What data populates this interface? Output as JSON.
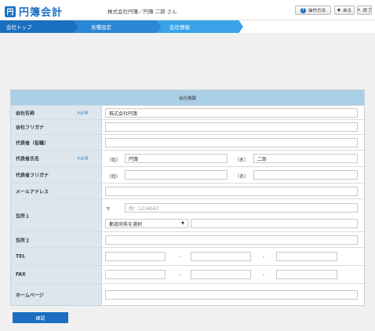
{
  "header": {
    "logo_icon": "円",
    "app_name": "円簿会計",
    "company_user": "株式会社円簿／円簿 二郎 さん",
    "help_label": "操作方法",
    "back_label": "戻る",
    "exit_label": "終了",
    "help_icon": "?",
    "back_icon": "◆",
    "exit_icon": "×"
  },
  "breadcrumb": [
    "会社トップ",
    "各種設定",
    "会社情報"
  ],
  "form": {
    "title": "会社情報",
    "required_mark": "※必須",
    "labels": {
      "company_name": "会社名称",
      "company_kana": "会社フリガナ",
      "representative_title": "代表者（役職）",
      "representative_name": "代表者氏名",
      "representative_kana": "代表者フリガナ",
      "email": "メールアドレス",
      "address1": "住所１",
      "address2": "住所２",
      "tel": "TEL",
      "fax": "FAX",
      "homepage": "ホームページ"
    },
    "values": {
      "company_name": "株式会社円簿",
      "last_name": "円簿",
      "first_name": "二郎"
    },
    "last_name_prefix": "（姓）",
    "first_name_prefix": "（名）",
    "postal_mark": "〒",
    "postal_placeholder": "例：1234567",
    "prefecture_select": "都道府県を選択",
    "phone_separator": "-"
  },
  "confirm_label": "確認"
}
